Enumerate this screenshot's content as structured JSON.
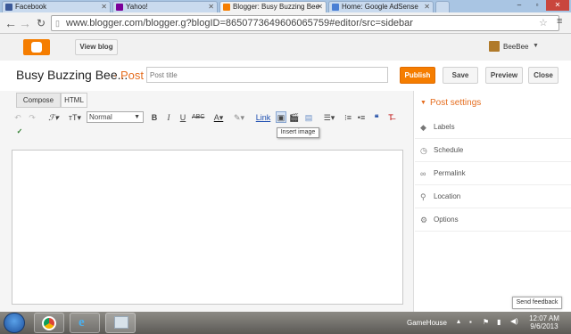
{
  "browser": {
    "tabs": [
      {
        "label": "Facebook",
        "favicon_color": "#3b5998"
      },
      {
        "label": "Yahoo!",
        "favicon_color": "#7b0099"
      },
      {
        "label": "Blogger: Busy Buzzing Bee",
        "favicon_color": "#f57d00"
      },
      {
        "label": "Home: Google AdSense",
        "favicon_color": "#4a7fd4"
      }
    ],
    "url": "www.blogger.com/blogger.g?blogID=8650773649606065759#editor/src=sidebar",
    "window_controls": [
      "–",
      "▫",
      "✕"
    ]
  },
  "blogger_header": {
    "view_blog": "View blog",
    "user_name": "BeeBee"
  },
  "post_header": {
    "blog_title": "Busy Buzzing Bee...",
    "post_tag": "· Post",
    "post_title_placeholder": "Post title",
    "publish": "Publish",
    "save": "Save",
    "preview": "Preview",
    "close": "Close"
  },
  "editor": {
    "modes": [
      "Compose",
      "HTML"
    ],
    "font_size": "Normal",
    "link": "Link",
    "tooltip": "Insert image",
    "toolbar_icons": [
      "undo-icon",
      "redo-icon",
      "font-family-icon",
      "font-size-icon",
      "bold-icon",
      "italic-icon",
      "underline-icon",
      "strikethrough-icon",
      "text-color-icon",
      "highlight-icon",
      "link-icon",
      "insert-image-icon",
      "insert-video-icon",
      "jump-break-icon",
      "align-icon",
      "numbered-list-icon",
      "bulleted-list-icon",
      "quote-icon",
      "remove-format-icon",
      "spellcheck-icon"
    ]
  },
  "sidebar": {
    "title": "Post settings",
    "items": [
      {
        "label": "Labels",
        "icon": "tag-icon"
      },
      {
        "label": "Schedule",
        "icon": "clock-icon"
      },
      {
        "label": "Permalink",
        "icon": "link-chain-icon"
      },
      {
        "label": "Location",
        "icon": "location-pin-icon"
      },
      {
        "label": "Options",
        "icon": "gear-icon"
      }
    ],
    "send_feedback": "Send feedback"
  },
  "taskbar": {
    "gamehouse": "GameHouse",
    "time": "12:07 AM",
    "date": "9/6/2013"
  },
  "colors": {
    "accent": "#f57d00",
    "link_orange": "#e56d1f"
  }
}
